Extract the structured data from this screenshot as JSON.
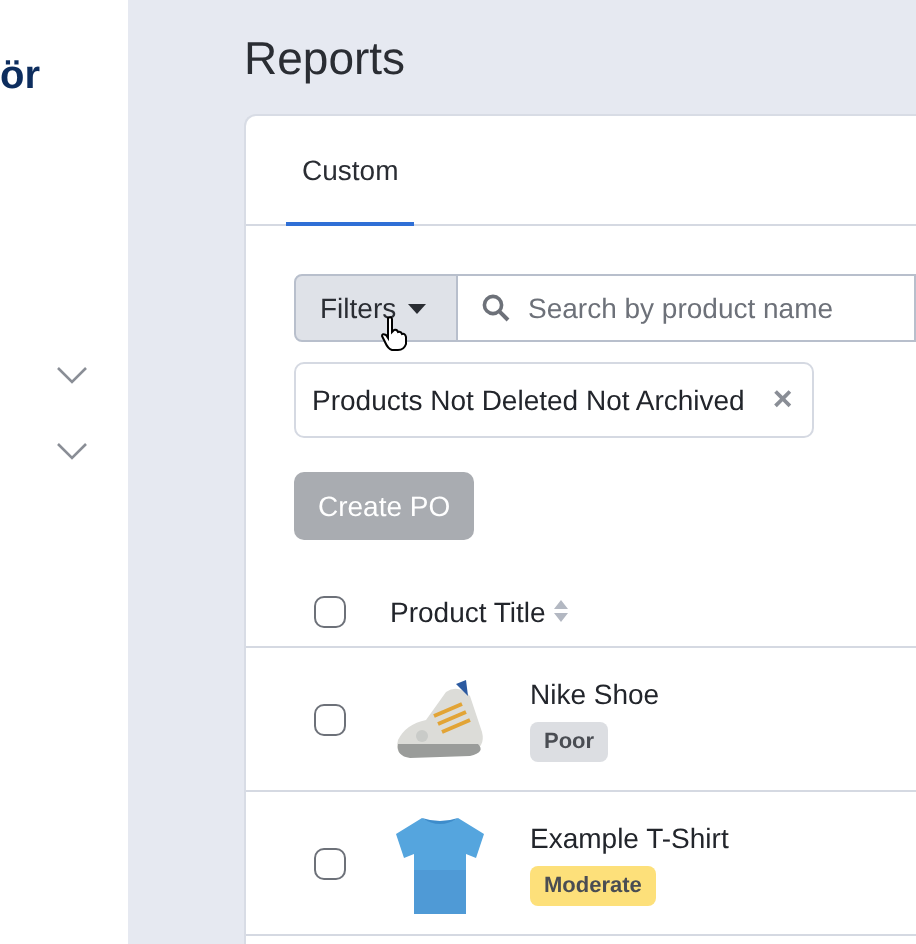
{
  "sidebar": {
    "logo": "ör",
    "items": [
      {
        "expanded": false
      },
      {
        "expanded": false
      }
    ]
  },
  "page": {
    "title": "Reports"
  },
  "tabs": [
    {
      "label": "Custom",
      "selected": true
    }
  ],
  "filters": {
    "button": "Filters",
    "search": {
      "placeholder": "Search by product name"
    },
    "chips": [
      {
        "label": "Products Not Deleted Not Archived",
        "remove": "×"
      }
    ]
  },
  "actions": {
    "create": {
      "label": "Create PO",
      "disabled": true
    }
  },
  "table": {
    "columns": [
      {
        "title": "Product Title",
        "sortable": true
      }
    ],
    "header_checked": false,
    "rows": [
      {
        "title": "Nike Shoe",
        "checked": false,
        "badge": {
          "text": "Poor",
          "color": "#dcdee2"
        }
      },
      {
        "title": "Example T-Shirt",
        "checked": false,
        "badge": {
          "text": "Moderate",
          "color": "#fde07a"
        }
      }
    ]
  }
}
